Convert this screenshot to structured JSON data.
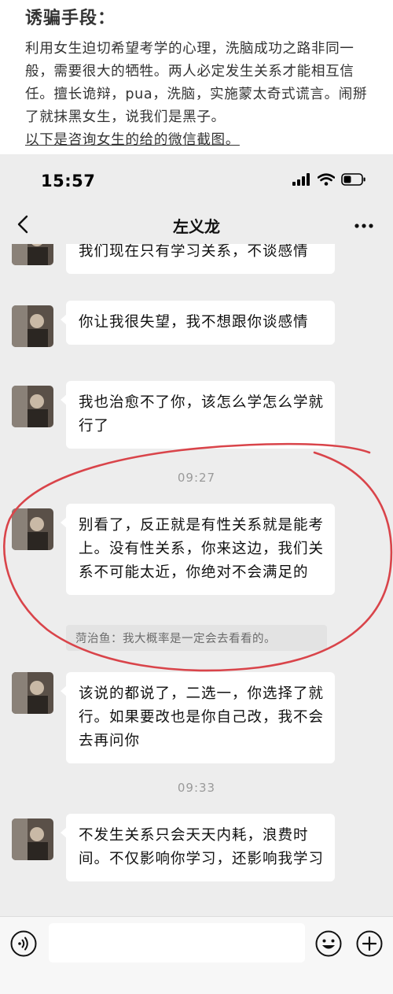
{
  "article": {
    "title": "诱骗手段：",
    "body": "利用女生迫切希望考学的心理，洗脑成功之路非同一般，需要很大的牺牲。两人必定发生关系才能相互信任。擅长诡辩，pua，洗脑，实施蒙太奇式谎言。闹掰了就抹黑女生，说我们是黑子。",
    "link": "以下是咨询女生的给的微信截图。"
  },
  "statusbar": {
    "time": "15:57"
  },
  "nav": {
    "title": "左义龙"
  },
  "chat": {
    "messages": [
      {
        "text": "我们现在只有学习关系，不谈感情"
      },
      {
        "text": "你让我很失望，我不想跟你谈感情"
      },
      {
        "text": "我也治愈不了你，该怎么学怎么学就行了"
      },
      {
        "timestamp": "09:27"
      },
      {
        "text": "别看了，反正就是有性关系就是能考上。没有性关系，你来这边，我们关系不可能太近，你绝对不会满足的"
      },
      {
        "quote": "菏治鱼：我大概率是一定会去看看的。"
      },
      {
        "text": "该说的都说了，二选一，你选择了就行。如果要改也是你自己改，我不会去再问你"
      },
      {
        "timestamp": "09:33"
      },
      {
        "text": "不发生关系只会天天内耗，浪费时间。不仅影响你学习，还影响我学习"
      }
    ]
  },
  "colors": {
    "chat_bg": "#ededed",
    "bubble": "#ffffff",
    "annotation": "#d9444a"
  }
}
